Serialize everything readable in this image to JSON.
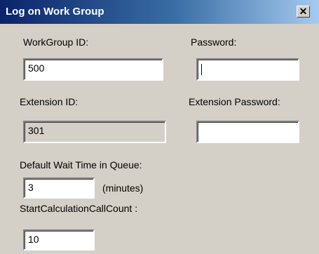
{
  "window": {
    "title": "Log on Work Group",
    "close_glyph": "✕"
  },
  "fields": {
    "workgroup_id": {
      "label": "WorkGroup ID:",
      "value": "500"
    },
    "password": {
      "label": "Password:",
      "value": ""
    },
    "extension_id": {
      "label": "Extension ID:",
      "value": "301"
    },
    "extension_password": {
      "label": "Extension Password:",
      "value": ""
    },
    "default_wait_time": {
      "label": "Default Wait Time in Queue:",
      "value": "3",
      "unit": "(minutes)"
    },
    "start_calc_call_count": {
      "label": "StartCalculationCallCount :",
      "value": "10"
    }
  }
}
